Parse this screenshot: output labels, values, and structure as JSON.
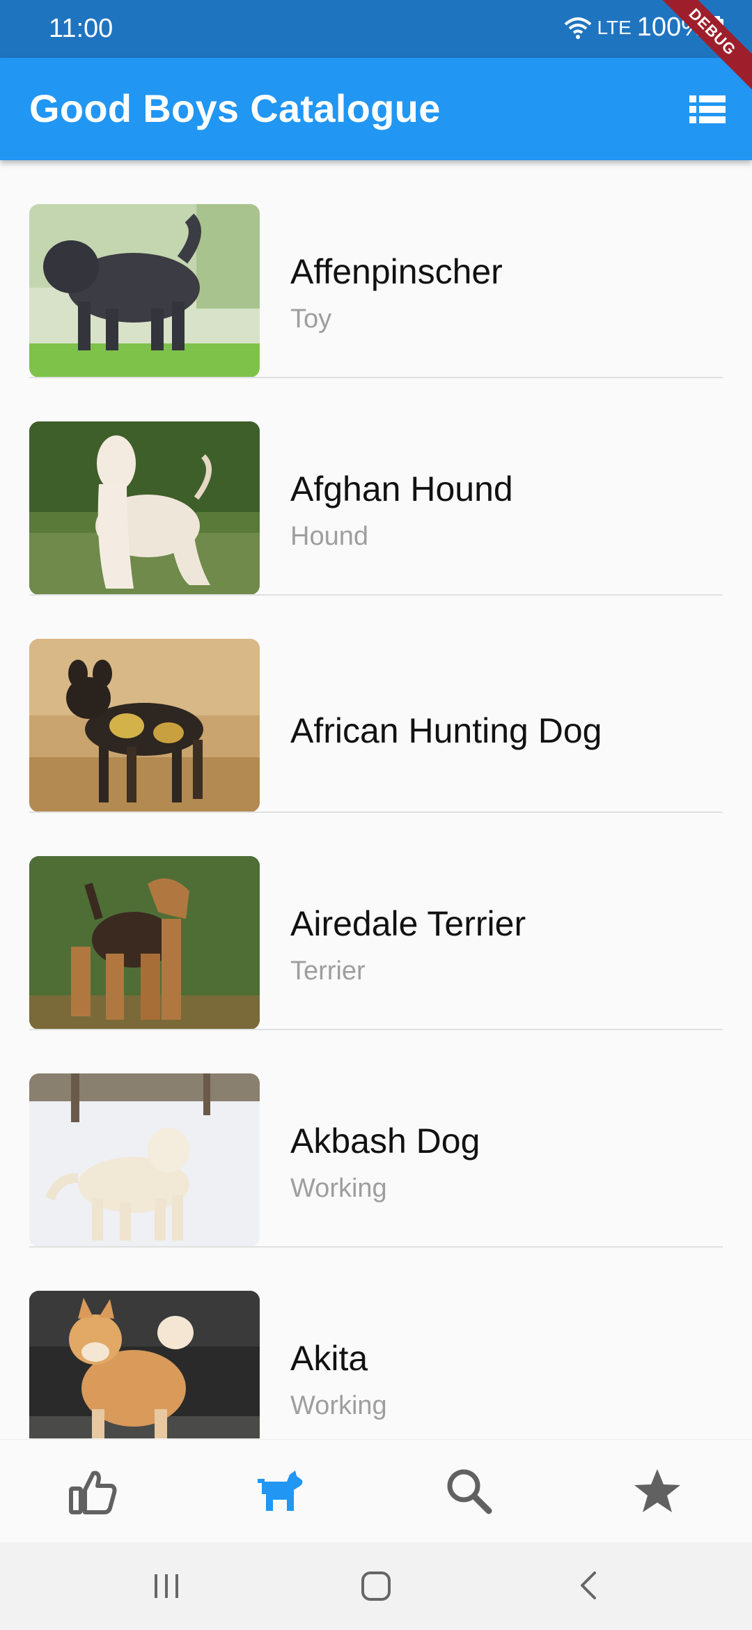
{
  "status_bar": {
    "time": "11:00",
    "network": "LTE",
    "battery": "100%"
  },
  "app_bar": {
    "title": "Good Boys Catalogue",
    "action_icon": "list-view-icon",
    "debug_banner": "DEBUG"
  },
  "breeds": [
    {
      "name": "Affenpinscher",
      "group": "Toy"
    },
    {
      "name": "Afghan Hound",
      "group": "Hound"
    },
    {
      "name": "African Hunting Dog",
      "group": ""
    },
    {
      "name": "Airedale Terrier",
      "group": "Terrier"
    },
    {
      "name": "Akbash Dog",
      "group": "Working"
    },
    {
      "name": "Akita",
      "group": "Working"
    }
  ],
  "bottom_nav": {
    "items": [
      {
        "icon": "thumbs-up-icon",
        "active": false
      },
      {
        "icon": "dog-icon",
        "active": true
      },
      {
        "icon": "search-icon",
        "active": false
      },
      {
        "icon": "star-icon",
        "active": false
      }
    ],
    "active_color": "#2196f3",
    "inactive_color": "#616161"
  },
  "colors": {
    "app_bar": "#2196f3",
    "status_bar": "#1f74c0"
  }
}
